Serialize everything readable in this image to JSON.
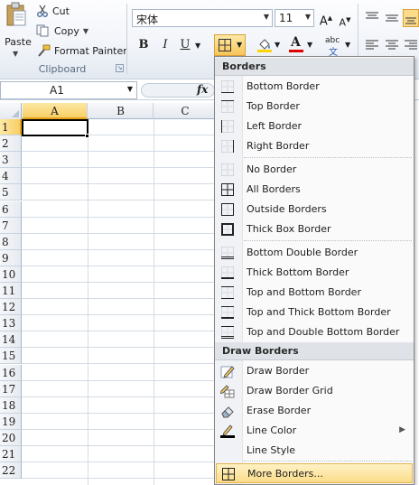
{
  "ribbon": {
    "clipboard": {
      "paste_label": "Paste",
      "cut_label": "Cut",
      "copy_label": "Copy",
      "format_painter_label": "Format Painter",
      "group_label": "Clipboard"
    },
    "font": {
      "name": "宋体",
      "size": "11",
      "grow_glyph": "A",
      "shrink_glyph": "A",
      "bold_glyph": "B",
      "italic_glyph": "I",
      "underline_glyph": "U",
      "fontcolor_glyph": "A",
      "phonetic_glyph": "abc"
    }
  },
  "formula_bar": {
    "name_box": "A1",
    "fx_label": "fx"
  },
  "sheet": {
    "columns": [
      "A",
      "B",
      "C"
    ],
    "rows": [
      "1",
      "2",
      "3",
      "4",
      "5",
      "6",
      "7",
      "8",
      "9",
      "10",
      "11",
      "12",
      "13",
      "14",
      "15",
      "16",
      "17",
      "18",
      "19",
      "20",
      "21",
      "22"
    ]
  },
  "borders_menu": {
    "header": "Borders",
    "items": [
      {
        "label": "Bottom Border",
        "icon": "bottom-border-icon"
      },
      {
        "label": "Top Border",
        "icon": "top-border-icon"
      },
      {
        "label": "Left Border",
        "icon": "left-border-icon"
      },
      {
        "label": "Right Border",
        "icon": "right-border-icon"
      },
      {
        "label": "No Border",
        "icon": "no-border-icon"
      },
      {
        "label": "All Borders",
        "icon": "all-borders-icon"
      },
      {
        "label": "Outside Borders",
        "icon": "outside-borders-icon"
      },
      {
        "label": "Thick Box Border",
        "icon": "thick-box-border-icon"
      },
      {
        "label": "Bottom Double Border",
        "icon": "bottom-double-border-icon"
      },
      {
        "label": "Thick Bottom Border",
        "icon": "thick-bottom-border-icon"
      },
      {
        "label": "Top and Bottom Border",
        "icon": "top-bottom-border-icon"
      },
      {
        "label": "Top and Thick Bottom Border",
        "icon": "top-thick-bottom-border-icon"
      },
      {
        "label": "Top and Double Bottom Border",
        "icon": "top-double-bottom-border-icon"
      }
    ],
    "draw_header": "Draw Borders",
    "draw_items": [
      {
        "label": "Draw Border",
        "icon": "pencil-icon"
      },
      {
        "label": "Draw Border Grid",
        "icon": "pencil-grid-icon"
      },
      {
        "label": "Erase Border",
        "icon": "eraser-icon"
      },
      {
        "label": "Line Color",
        "icon": "line-color-icon"
      },
      {
        "label": "Line Style",
        "icon": ""
      },
      {
        "label": "More Borders...",
        "icon": "all-borders-icon"
      }
    ],
    "submenu_arrow": "▶"
  },
  "colors": {
    "highlight": "#fbdc8a",
    "selection_border": "#e3a21a",
    "menu_header_bg": "#dfe3e8"
  }
}
